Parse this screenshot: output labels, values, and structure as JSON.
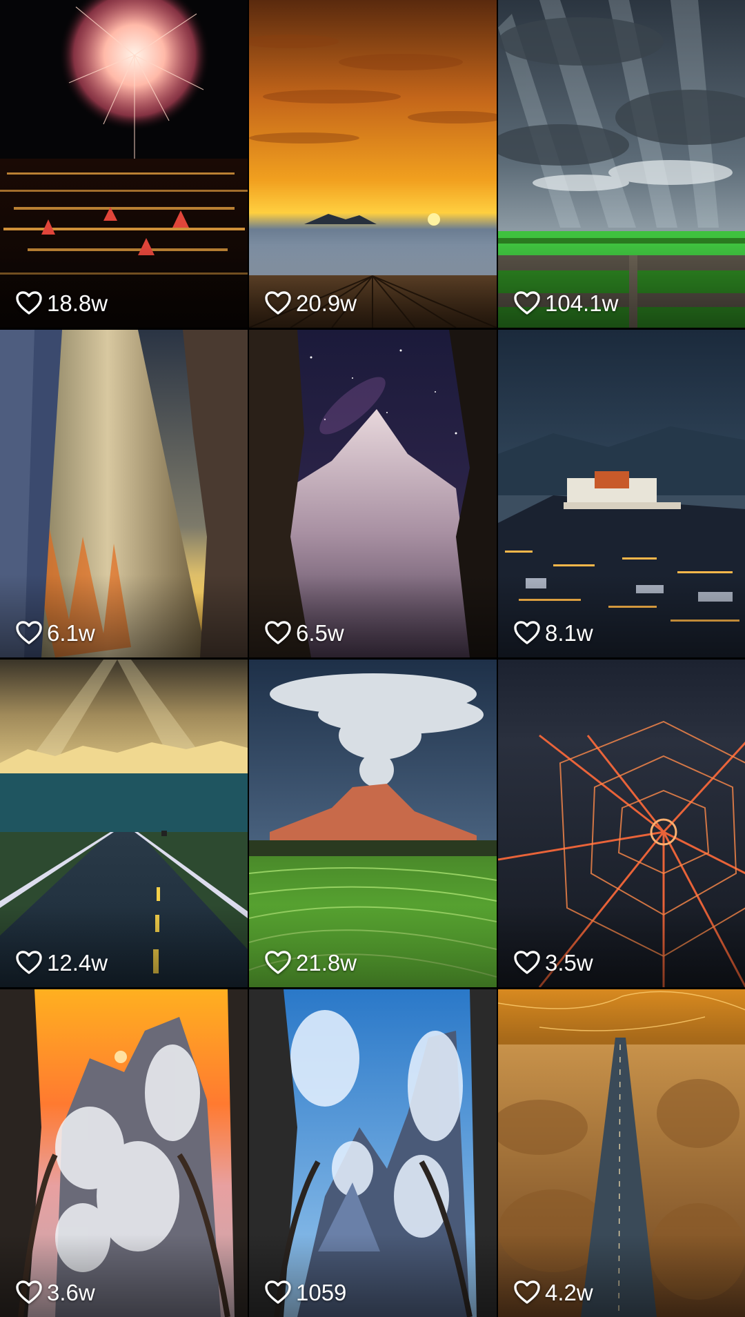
{
  "tiles": [
    {
      "name": "tile-fireworks-city",
      "likes": "18.8w"
    },
    {
      "name": "tile-sunset-boardwalk",
      "likes": "20.9w"
    },
    {
      "name": "tile-sun-rays-field",
      "likes": "104.1w"
    },
    {
      "name": "tile-canyon-walls",
      "likes": "6.1w"
    },
    {
      "name": "tile-starry-mountain",
      "likes": "6.5w"
    },
    {
      "name": "tile-palace-city-night",
      "likes": "8.1w"
    },
    {
      "name": "tile-mountain-road",
      "likes": "12.4w"
    },
    {
      "name": "tile-volcano-terraces",
      "likes": "21.8w"
    },
    {
      "name": "tile-radial-city-lights",
      "likes": "3.5w"
    },
    {
      "name": "tile-snowy-sunset-cliffs",
      "likes": "3.6w"
    },
    {
      "name": "tile-snowy-blue-sky",
      "likes": "1059"
    },
    {
      "name": "tile-desert-highway",
      "likes": "4.2w"
    }
  ],
  "icons": {
    "like": "heart-outline-icon"
  },
  "colors": {
    "background": "#000000",
    "text": "#ffffff"
  }
}
